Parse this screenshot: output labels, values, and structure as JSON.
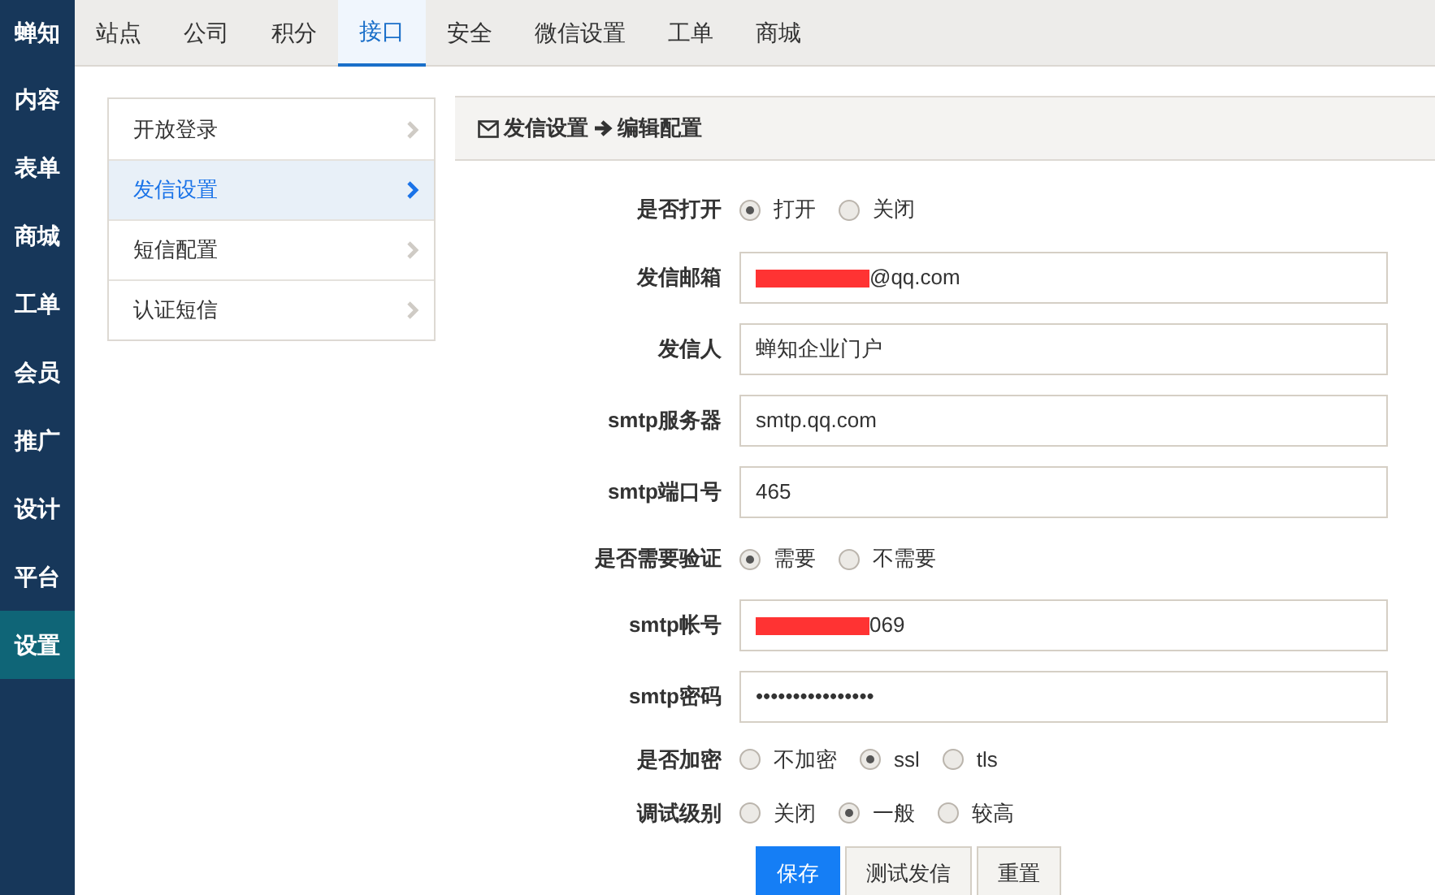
{
  "brand": "蝉知",
  "side_nav": [
    {
      "label": "内容",
      "selected": false
    },
    {
      "label": "表单",
      "selected": false
    },
    {
      "label": "商城",
      "selected": false
    },
    {
      "label": "工单",
      "selected": false
    },
    {
      "label": "会员",
      "selected": false
    },
    {
      "label": "推广",
      "selected": false
    },
    {
      "label": "设计",
      "selected": false
    },
    {
      "label": "平台",
      "selected": false
    },
    {
      "label": "设置",
      "selected": true
    }
  ],
  "top_tabs": [
    {
      "label": "站点",
      "selected": false
    },
    {
      "label": "公司",
      "selected": false
    },
    {
      "label": "积分",
      "selected": false
    },
    {
      "label": "接口",
      "selected": true
    },
    {
      "label": "安全",
      "selected": false
    },
    {
      "label": "微信设置",
      "selected": false
    },
    {
      "label": "工单",
      "selected": false
    },
    {
      "label": "商城",
      "selected": false
    }
  ],
  "sub_menu": [
    {
      "label": "开放登录",
      "selected": false
    },
    {
      "label": "发信设置",
      "selected": true
    },
    {
      "label": "短信配置",
      "selected": false
    },
    {
      "label": "认证短信",
      "selected": false
    }
  ],
  "panel": {
    "title": "发信设置",
    "subtitle": "编辑配置"
  },
  "form": [
    {
      "kind": "radio",
      "label": "是否打开",
      "options": [
        {
          "label": "打开",
          "selected": true
        },
        {
          "label": "关闭",
          "selected": false
        }
      ]
    },
    {
      "kind": "field",
      "label": "发信邮箱",
      "value": "@qq.com",
      "redacted": true
    },
    {
      "kind": "field",
      "label": "发信人",
      "value": "蝉知企业门户",
      "redacted": false
    },
    {
      "kind": "field",
      "label": "smtp服务器",
      "value": "smtp.qq.com",
      "redacted": false
    },
    {
      "kind": "field",
      "label": "smtp端口号",
      "value": "465",
      "redacted": false
    },
    {
      "kind": "radio",
      "label": "是否需要验证",
      "options": [
        {
          "label": "需要",
          "selected": true
        },
        {
          "label": "不需要",
          "selected": false
        }
      ]
    },
    {
      "kind": "field",
      "label": "smtp帐号",
      "value": "069",
      "redacted": true
    },
    {
      "kind": "field",
      "label": "smtp密码",
      "value": "••••••••••••••••",
      "redacted": false
    },
    {
      "kind": "radio",
      "label": "是否加密",
      "options": [
        {
          "label": "不加密",
          "selected": false
        },
        {
          "label": "ssl",
          "selected": true
        },
        {
          "label": "tls",
          "selected": false
        }
      ]
    },
    {
      "kind": "radio",
      "label": "调试级别",
      "options": [
        {
          "label": "关闭",
          "selected": false
        },
        {
          "label": "一般",
          "selected": true
        },
        {
          "label": "较高",
          "selected": false
        }
      ]
    }
  ],
  "buttons": [
    {
      "label": "保存",
      "kind": "primary"
    },
    {
      "label": "测试发信",
      "kind": "default"
    },
    {
      "label": "重置",
      "kind": "default"
    }
  ]
}
